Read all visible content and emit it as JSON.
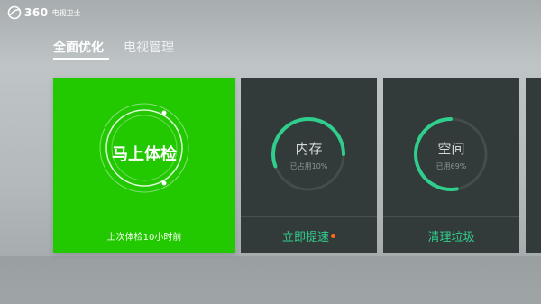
{
  "app": {
    "brand_number": "360",
    "brand_name": "电视卫士"
  },
  "tabs": [
    {
      "label": "全面优化",
      "active": true
    },
    {
      "label": "电视管理",
      "active": false
    }
  ],
  "cards": {
    "checkup": {
      "title": "马上体检",
      "footer": "上次体检10小时前",
      "color": "#22c800"
    },
    "memory": {
      "title": "内存",
      "subtitle": "已占用10%",
      "used_percent": 10,
      "action": "立即提速",
      "has_badge": true,
      "accent": "#2fce8d"
    },
    "space": {
      "title": "空间",
      "subtitle": "已用69%",
      "used_percent": 69,
      "action": "清理垃圾",
      "accent": "#2fce8d"
    }
  }
}
